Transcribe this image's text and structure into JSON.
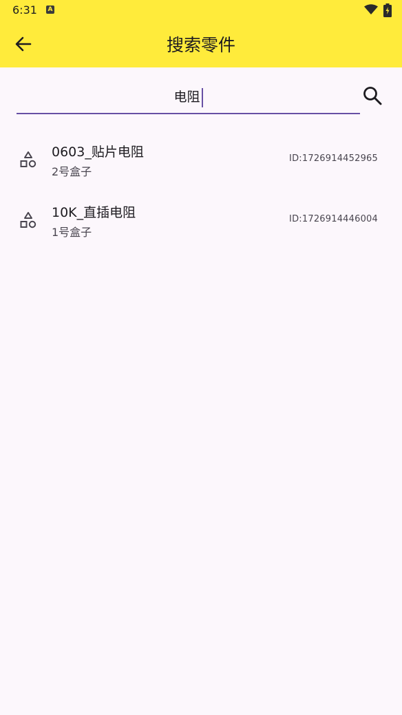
{
  "status_bar": {
    "time": "6:31",
    "notification_icon": "A"
  },
  "app_bar": {
    "title": "搜索零件"
  },
  "search": {
    "value": "电阻"
  },
  "results": [
    {
      "name": "0603_贴片电阻",
      "location": "2号盒子",
      "id": "ID:1726914452965",
      "icon": "category-shapes-icon"
    },
    {
      "name": "10K_直插电阻",
      "location": "1号盒子",
      "id": "ID:1726914446004",
      "icon": "category-shapes-icon"
    }
  ],
  "colors": {
    "app_bar": "#ffeb3b",
    "background": "#fcf7fc",
    "accent": "#6750a4"
  }
}
